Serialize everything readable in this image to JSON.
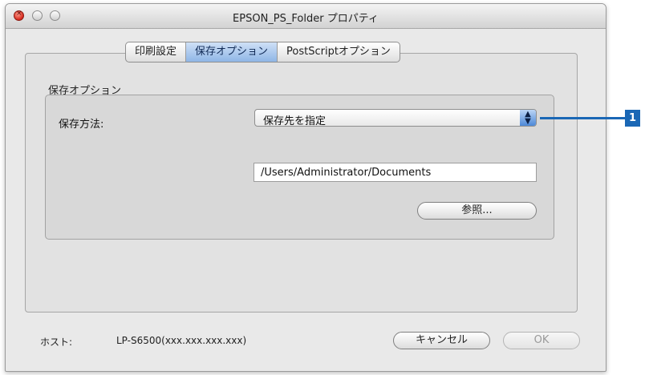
{
  "window": {
    "title": "EPSON_PS_Folder プロパティ"
  },
  "tabs": [
    {
      "label": "印刷設定",
      "active": false
    },
    {
      "label": "保存オプション",
      "active": true
    },
    {
      "label": "PostScriptオプション",
      "active": false
    }
  ],
  "save_options": {
    "group_label": "保存オプション",
    "method_label": "保存方法:",
    "method_value": "保存先を指定",
    "path_value": "/Users/Administrator/Documents",
    "browse_label": "参照..."
  },
  "footer": {
    "host_label": "ホスト:",
    "host_value": "LP-S6500(xxx.xxx.xxx.xxx)",
    "cancel_label": "キャンセル",
    "ok_label": "OK"
  },
  "callout": {
    "number": "1",
    "color": "#1a67b5"
  }
}
